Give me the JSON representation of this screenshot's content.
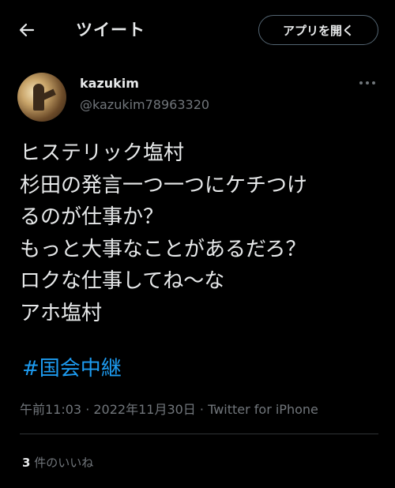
{
  "header": {
    "title": "ツイート",
    "open_app_label": "アプリを開く",
    "back_icon": "arrow-left-icon"
  },
  "author": {
    "name": "kazukim",
    "handle": "@kazukim78963320"
  },
  "tweet": {
    "lines": [
      "ヒステリック塩村",
      "杉田の発言一つ一つにケチつけ",
      "るのが仕事か？",
      "もっと大事なことがあるだろ？",
      "ロクな仕事してね〜な",
      "アホ塩村"
    ],
    "hashtag": "#国会中継",
    "timestamp": "午前11:03 · 2022年11月30日 · Twitter for iPhone"
  },
  "stats": {
    "likes_count": "3",
    "likes_label": " 件のいいね"
  },
  "colors": {
    "background": "#000000",
    "text": "#e7e9ea",
    "secondary": "#71767b",
    "link": "#1d9bf0",
    "border": "#2f3336"
  }
}
